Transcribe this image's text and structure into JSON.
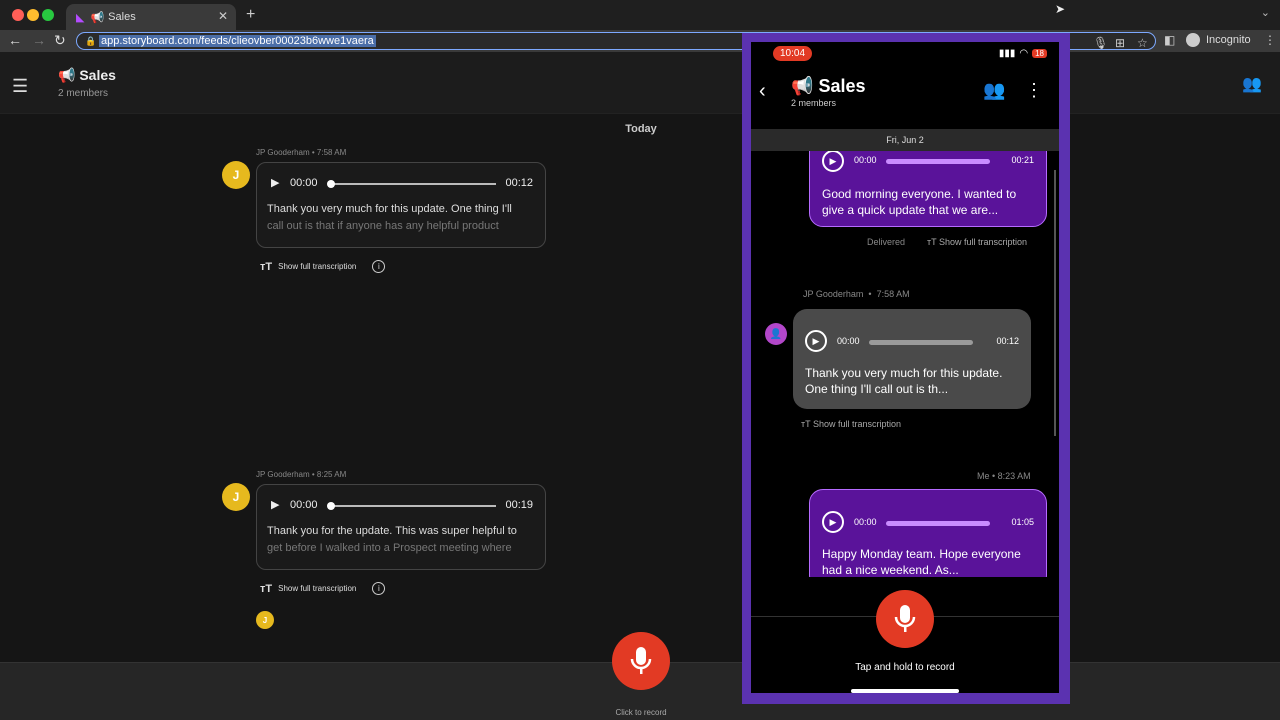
{
  "browser": {
    "tab_title": "Sales",
    "url": "app.storyboard.com/feeds/clieovber00023b6wwe1vaera",
    "profile_label": "Incognito",
    "colors": {
      "dot_red": "#ff5f57",
      "dot_yellow": "#febc2e",
      "dot_green": "#28c840"
    }
  },
  "desktop": {
    "feed_title": "Sales",
    "feed_members": "2 members",
    "date_separator": "Today",
    "messages": [
      {
        "author_initial": "J",
        "meta": "JP Gooderham • 7:58 AM",
        "time_start": "00:00",
        "time_end": "00:12",
        "text_line1": "Thank you very much for this update. One thing I'll",
        "text_line2": "call out is that if anyone has any helpful product",
        "transcription_label": "Show full transcription"
      },
      {
        "author_initial": "J",
        "meta": "JP Gooderham • 8:25 AM",
        "time_start": "00:00",
        "time_end": "00:19",
        "text_line1": "Thank you for the update. This was super helpful to",
        "text_line2": "get before I walked into a Prospect meeting where",
        "transcription_label": "Show full transcription"
      }
    ],
    "reader_initial": "J",
    "record_label": "Click to record"
  },
  "phone": {
    "time": "10:04",
    "battery": "18",
    "feed_title": "Sales",
    "feed_members": "2 members",
    "date_bar": "Fri, Jun 2",
    "messages": [
      {
        "time_start": "00:00",
        "time_end": "00:21",
        "text": "Good morning everyone. I wanted to give a quick update that we are...",
        "status": "Delivered",
        "transcription_label": "Show full transcription"
      },
      {
        "meta_author": "JP Gooderham",
        "meta_time": "7:58 AM",
        "time_start": "00:00",
        "time_end": "00:12",
        "text": "Thank you very much for this update. One thing I'll call out is th...",
        "transcription_label": "Show full transcription"
      },
      {
        "meta": "Me  •  8:23 AM",
        "time_start": "00:00",
        "time_end": "01:05",
        "text": "Happy Monday team. Hope everyone had a nice weekend. As..."
      }
    ],
    "record_label": "Tap and hold to record"
  }
}
